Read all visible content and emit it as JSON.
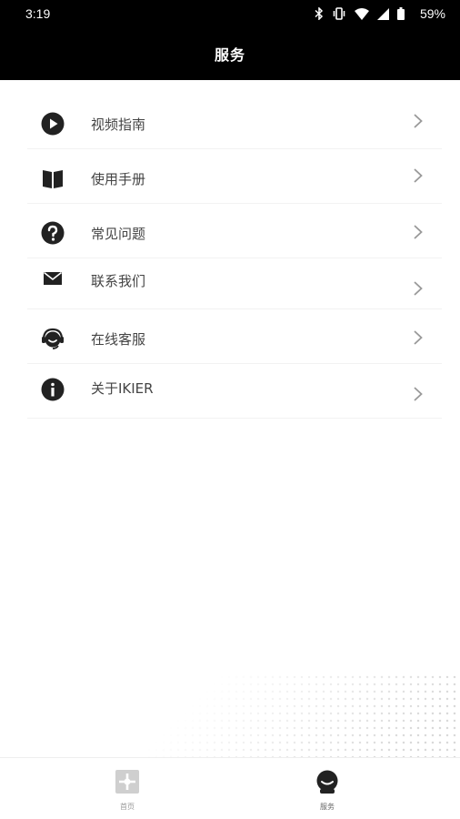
{
  "status_bar": {
    "time": "3:19",
    "battery": "59%",
    "icons": [
      "bluetooth-icon",
      "vibrate-icon",
      "wifi-icon",
      "signal-icon",
      "battery-icon"
    ]
  },
  "header": {
    "title": "服务"
  },
  "menu": {
    "items": [
      {
        "label": "视频指南",
        "icon": "play-icon"
      },
      {
        "label": "使用手册",
        "icon": "book-icon"
      },
      {
        "label": "常见问题",
        "icon": "question-icon"
      },
      {
        "label": "联系我们",
        "icon": "mail-icon"
      },
      {
        "label": "在线客服",
        "icon": "headset-icon"
      },
      {
        "label": "关于IKIER",
        "icon": "info-icon"
      }
    ]
  },
  "tabbar": {
    "tabs": [
      {
        "label": "首页",
        "icon": "home-icon",
        "active": false
      },
      {
        "label": "服务",
        "icon": "service-icon",
        "active": true
      }
    ]
  },
  "colors": {
    "header_bg": "#000000",
    "icon": "#222222",
    "chevron": "#999999"
  }
}
